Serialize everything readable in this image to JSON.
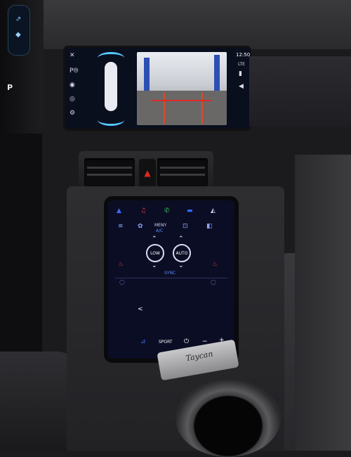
{
  "top_screen": {
    "clock": "12:50",
    "icons": [
      "close-icon",
      "park-assist-icon",
      "camera-icon",
      "sensor-icon",
      "settings-icon"
    ],
    "status_icons": [
      "lte-icon",
      "signal-icon",
      "volume-icon"
    ]
  },
  "climate": {
    "apps": [
      "apple-carplay-icon",
      "music-icon",
      "phone-icon",
      "car-icon",
      "compass-icon"
    ],
    "menu_label": "MENY",
    "menu_sub": "A/C",
    "left_mode": "LOW",
    "right_mode": "AUTO",
    "sync_label": "SYNC",
    "sport_label": "SPORT",
    "minus_label": "−",
    "plus_label": "+",
    "back_label": "<"
  },
  "trim": {
    "badge_text": "Taycan"
  },
  "colors": {
    "accent": "#3d6bff",
    "screen_bg": "#0b0d24",
    "hazard": "#e0281f"
  }
}
